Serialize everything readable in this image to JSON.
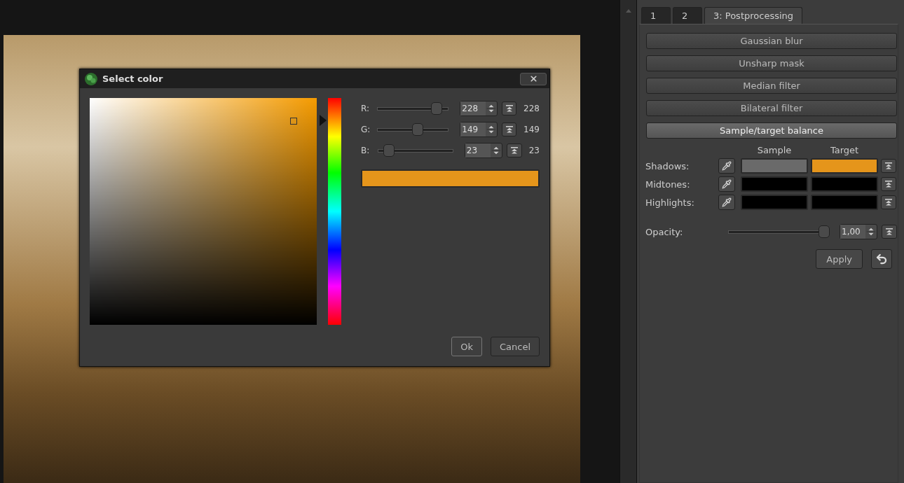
{
  "dialog": {
    "title": "Select color",
    "channels": [
      {
        "label": "R:",
        "level": 0.89,
        "value": "228",
        "reading": "228"
      },
      {
        "label": "G:",
        "level": 0.58,
        "value": "149",
        "reading": "149"
      },
      {
        "label": "B:",
        "level": 0.09,
        "value": "23",
        "reading": "23"
      }
    ],
    "preview": {
      "color": "#e5951b"
    },
    "buttons": [
      {
        "label": "Ok",
        "default": true
      },
      {
        "label": "Cancel",
        "default": false
      }
    ]
  },
  "panel": {
    "tabs": [
      {
        "label": "1",
        "selected": false
      },
      {
        "label": "2",
        "selected": false
      },
      {
        "label": "3: Postprocessing",
        "selected": true
      }
    ],
    "filters": [
      {
        "label": "Gaussian blur",
        "selected": false
      },
      {
        "label": "Unsharp mask",
        "selected": false
      },
      {
        "label": "Median filter",
        "selected": false
      },
      {
        "label": "Bilateral filter",
        "selected": false
      },
      {
        "label": "Sample/target balance",
        "selected": true
      }
    ],
    "headers": [
      "Sample",
      "Target"
    ],
    "rows": [
      {
        "label": "Shadows:",
        "swatches": [
          {
            "color": "#6a6a6a"
          },
          {
            "color": "#e5951b"
          }
        ]
      },
      {
        "label": "Midtones:",
        "swatches": [
          {
            "color": "#000000"
          },
          {
            "color": "#000000"
          }
        ]
      },
      {
        "label": "Highlights:",
        "swatches": [
          {
            "color": "#000000"
          },
          {
            "color": "#000000"
          }
        ]
      }
    ],
    "opacity": {
      "label": "Opacity:",
      "level": 1.0,
      "value": "1,00"
    },
    "apply": "Apply"
  }
}
